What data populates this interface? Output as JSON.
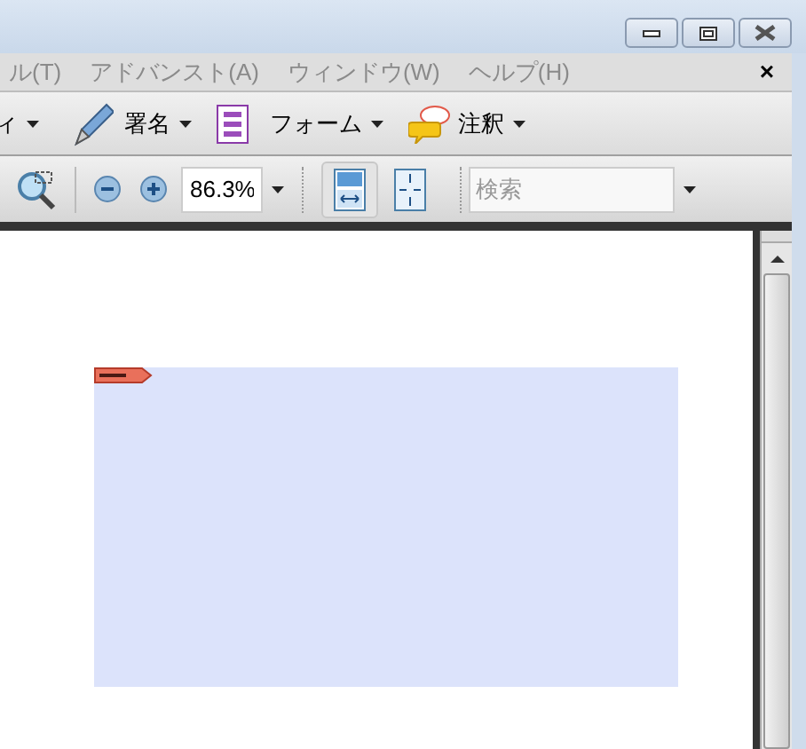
{
  "menu": [
    {
      "label": "ル(T)"
    },
    {
      "label": "アドバンスト(A)"
    },
    {
      "label": "ウィンドウ(W)"
    },
    {
      "label": "ヘルプ(H)"
    }
  ],
  "menu_close": "×",
  "toolbar": [
    {
      "kind": "cut",
      "label": "ィ"
    },
    {
      "kind": "sign",
      "label": "署名"
    },
    {
      "kind": "form",
      "label": "フォーム"
    },
    {
      "kind": "comment",
      "label": "注釈"
    }
  ],
  "view_toolbar": {
    "zoom_value": "86.3%",
    "fit_width_selected": true,
    "fit_page_selected": false,
    "search_placeholder": "検索"
  }
}
